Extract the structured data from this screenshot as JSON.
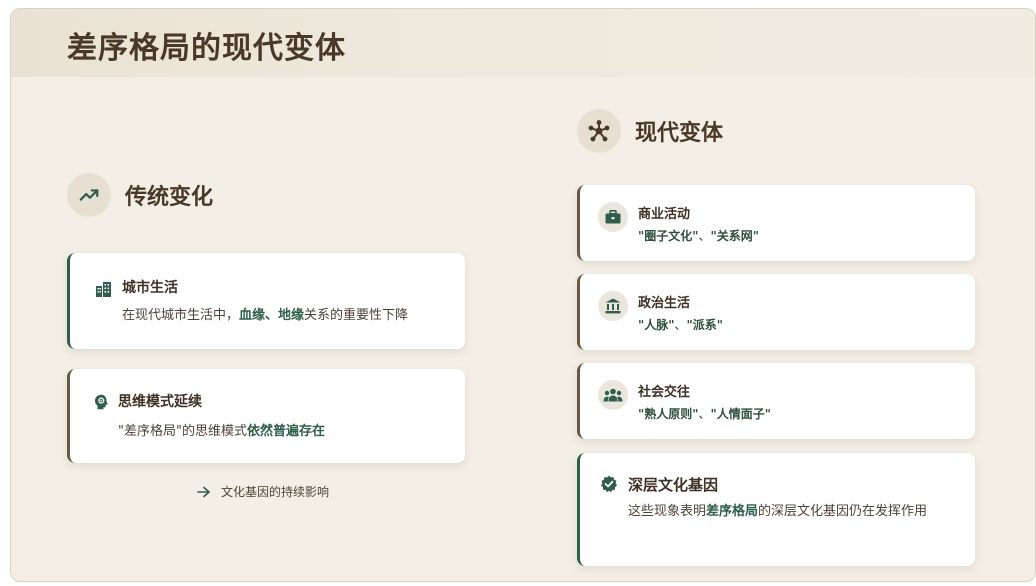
{
  "page": {
    "title": "差序格局的现代变体"
  },
  "left": {
    "heading": "传统变化",
    "heading_icon": "trending-up-icon",
    "cards": [
      {
        "icon": "city-icon",
        "title": "城市生活",
        "text_before": "在现代城市生活中，",
        "highlight": "血缘、地缘",
        "text_after": "关系的重要性下降"
      },
      {
        "icon": "brain-head-icon",
        "title": "思维模式延续",
        "text_before": "\"差序格局\"的思维模式",
        "highlight": "依然普遍存在",
        "text_after": ""
      }
    ],
    "footer": {
      "icon": "arrow-right-icon",
      "text": "文化基因的持续影响"
    }
  },
  "right": {
    "heading": "现代变体",
    "heading_icon": "network-icon",
    "cards": [
      {
        "icon": "briefcase-icon",
        "title": "商业活动",
        "detail_a": "\"圈子文化\"",
        "sep": "、",
        "detail_b": "\"关系网\""
      },
      {
        "icon": "government-building-icon",
        "title": "政治生活",
        "detail_a": "\"人脉\"",
        "sep": "、",
        "detail_b": "\"派系\""
      },
      {
        "icon": "people-group-icon",
        "title": "社会交往",
        "detail_a": "\"熟人原则\"",
        "sep": "、",
        "detail_b": "\"人情面子\""
      }
    ],
    "deep": {
      "icon": "verified-check-icon",
      "title": "深层文化基因",
      "text_before": "这些现象表明",
      "highlight": "差序格局",
      "text_after": "的深层文化基因仍在发挥作用"
    }
  },
  "colors": {
    "accent_green": "#2f5f4c",
    "accent_brown": "#6b5842",
    "background": "#f3efe6"
  }
}
